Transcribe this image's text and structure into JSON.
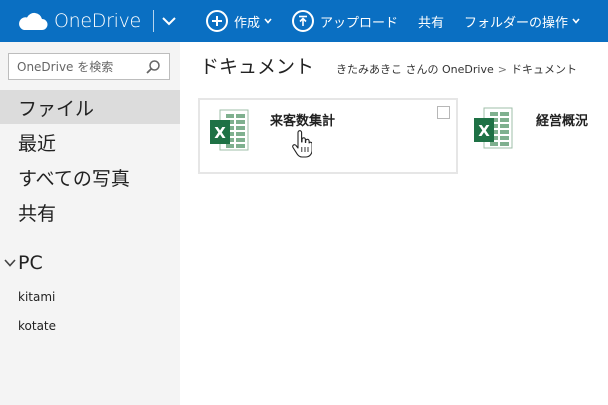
{
  "topbar": {
    "brand": "OneDrive",
    "commands": [
      {
        "label": "作成"
      },
      {
        "label": "アップロード"
      },
      {
        "label": "共有"
      },
      {
        "label": "フォルダーの操作"
      }
    ]
  },
  "sidebar": {
    "search_placeholder": "OneDrive を検索",
    "items": [
      {
        "label": "ファイル"
      },
      {
        "label": "最近"
      },
      {
        "label": "すべての写真"
      },
      {
        "label": "共有"
      }
    ],
    "pc_label": "PC",
    "pc_items": [
      {
        "label": "kitami"
      },
      {
        "label": "kotate"
      }
    ]
  },
  "main": {
    "title": "ドキュメント",
    "breadcrumb": [
      "きたみあきこ さんの OneDrive",
      "ドキュメント"
    ],
    "breadcrumb_sep": ">",
    "files": [
      {
        "name": "来客数集計",
        "type": "excel"
      },
      {
        "name": "経営概況",
        "type": "excel"
      }
    ]
  },
  "colors": {
    "topbar": "#0a6fc2",
    "excel_green": "#1e7145",
    "sidebar_bg": "#f4f4f4",
    "active_bg": "#dcdcdc"
  },
  "icons": {
    "brand": "cloud-icon",
    "create": "plus-circle-icon",
    "upload": "upload-circle-icon",
    "search": "search-icon",
    "file": "excel-icon"
  }
}
